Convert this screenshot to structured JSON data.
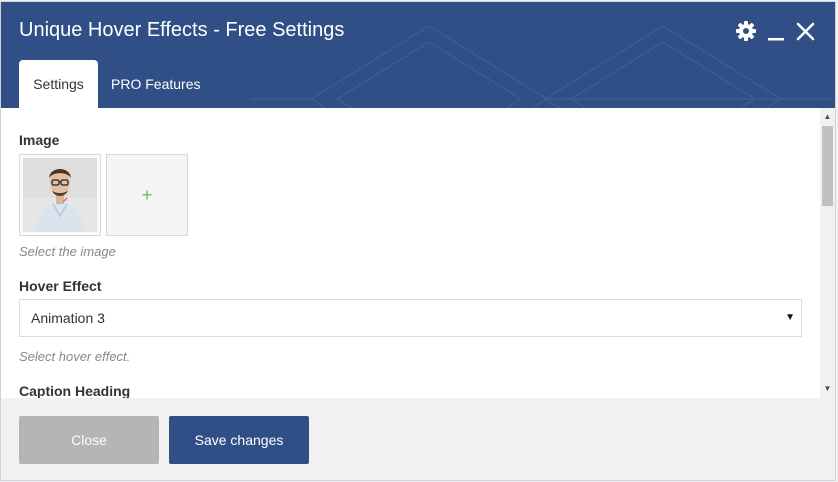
{
  "window": {
    "title": "Unique Hover Effects - Free Settings"
  },
  "tabs": [
    {
      "label": "Settings",
      "active": true
    },
    {
      "label": "PRO Features",
      "active": false
    }
  ],
  "header_icons": [
    "gear-icon",
    "minimize-icon",
    "close-icon"
  ],
  "fields": {
    "image": {
      "label": "Image",
      "description": "Select the image",
      "add_symbol": "+"
    },
    "hover_effect": {
      "label": "Hover Effect",
      "selected": "Animation 3",
      "description": "Select hover effect."
    },
    "caption_heading": {
      "label": "Caption Heading"
    }
  },
  "buttons": {
    "close_label": "Close",
    "save_label": "Save changes"
  },
  "colors": {
    "header_bg": "#2f4f86",
    "primary_button": "#2f4f86",
    "disabled_button": "#b5b5b5",
    "add_icon": "#7ab648"
  }
}
